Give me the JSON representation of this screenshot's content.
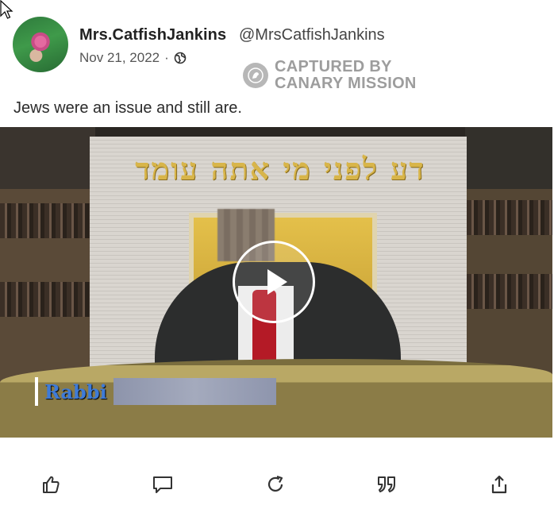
{
  "post": {
    "display_name": "Mrs.CatfishJankins",
    "handle": "@MrsCatfishJankins",
    "date": "Nov 21, 2022",
    "separator": "·",
    "visibility_icon": "globe-icon",
    "text": "Jews were an issue and still are."
  },
  "watermark": {
    "line1": "CAPTURED BY",
    "line2": "CANARY MISSION"
  },
  "video": {
    "hebrew_sign": "דע לפני מי אתה עומד",
    "lower_third_label": "Rabbi",
    "play_icon": "play-icon"
  },
  "actions": [
    {
      "icon": "like-icon"
    },
    {
      "icon": "comment-icon"
    },
    {
      "icon": "repost-icon"
    },
    {
      "icon": "quote-icon"
    },
    {
      "icon": "share-icon"
    }
  ],
  "colors": {
    "accent_gold": "#d8b54a",
    "tie_red": "#b41a26",
    "caption_blue": "#3e7bd8"
  }
}
